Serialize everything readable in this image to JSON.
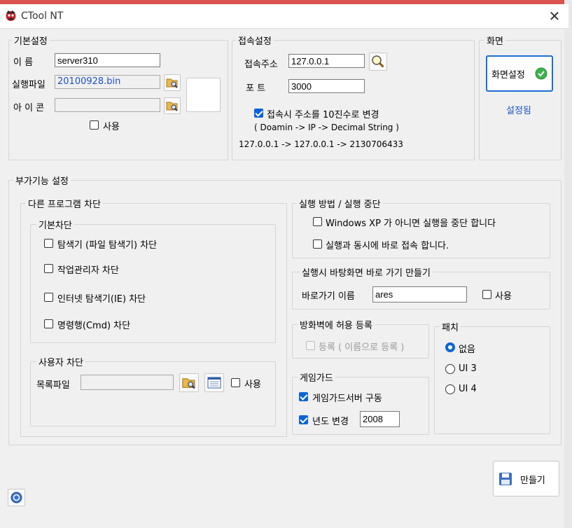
{
  "window": {
    "title": "CTool NT",
    "close_glyph": "✕"
  },
  "basic": {
    "group_label": "기본설정",
    "name_label": "이   름",
    "name_value": "server310",
    "exec_label": "실행파일",
    "exec_value": "20100928.bin",
    "icon_label": "아 이 콘",
    "icon_value": "",
    "use_label": "사용"
  },
  "connect": {
    "group_label": "접속설정",
    "addr_label": "접속주소",
    "addr_value": "127.0.0.1",
    "port_label": "포      트",
    "port_value": "3000",
    "decimal_label": "접속시 주소를 10진수로 변경",
    "decimal_hint": "( Doamin -> IP -> Decimal String )",
    "conversion": "127.0.0.1 -> 127.0.0.1 -> 2130706433"
  },
  "screen": {
    "group_label": "화면",
    "button_label": "화면설정",
    "status": "설정됨"
  },
  "addon": {
    "group_label": "부가기능 설정",
    "block": {
      "group_label": "다른 프로그램 차단",
      "basic_label": "기본차단",
      "items": [
        "탐색기 (파일 탐색기) 차단",
        "작업관리자 차단",
        "인터넷 탐색기(IE) 차단",
        "명령행(Cmd) 차단"
      ],
      "user_label": "사용자 차단",
      "list_file_label": "목록파일",
      "list_file_value": "",
      "use_label": "사용"
    },
    "run": {
      "group_label": "실행 방법 / 실행 중단",
      "xp_label": "Windows XP 가 아니면 실행을 중단 합니다",
      "connect_label": "실행과 동시에 바로 접속 합니다."
    },
    "shortcut": {
      "group_label": "실행시 바탕화면 바로 가기 만들기",
      "name_label": "바로가기 이름",
      "name_value": "ares",
      "use_label": "사용"
    },
    "firewall": {
      "group_label": "방화벽에 허용 등록",
      "register_label": "등록 ( 이름으로 등록 )"
    },
    "gameguard": {
      "group_label": "게임가드",
      "server_label": "게임가드서버 구동",
      "year_label": "년도 변경",
      "year_value": "2008"
    },
    "patch": {
      "group_label": "패치",
      "options": [
        "없음",
        "UI 3",
        "UI 4"
      ],
      "selected": "없음"
    }
  },
  "footer": {
    "make_label": "만들기"
  },
  "colors": {
    "accent": "#0a64d8",
    "status_blue": "#1c52c7",
    "check_green": "#3cb34a"
  }
}
